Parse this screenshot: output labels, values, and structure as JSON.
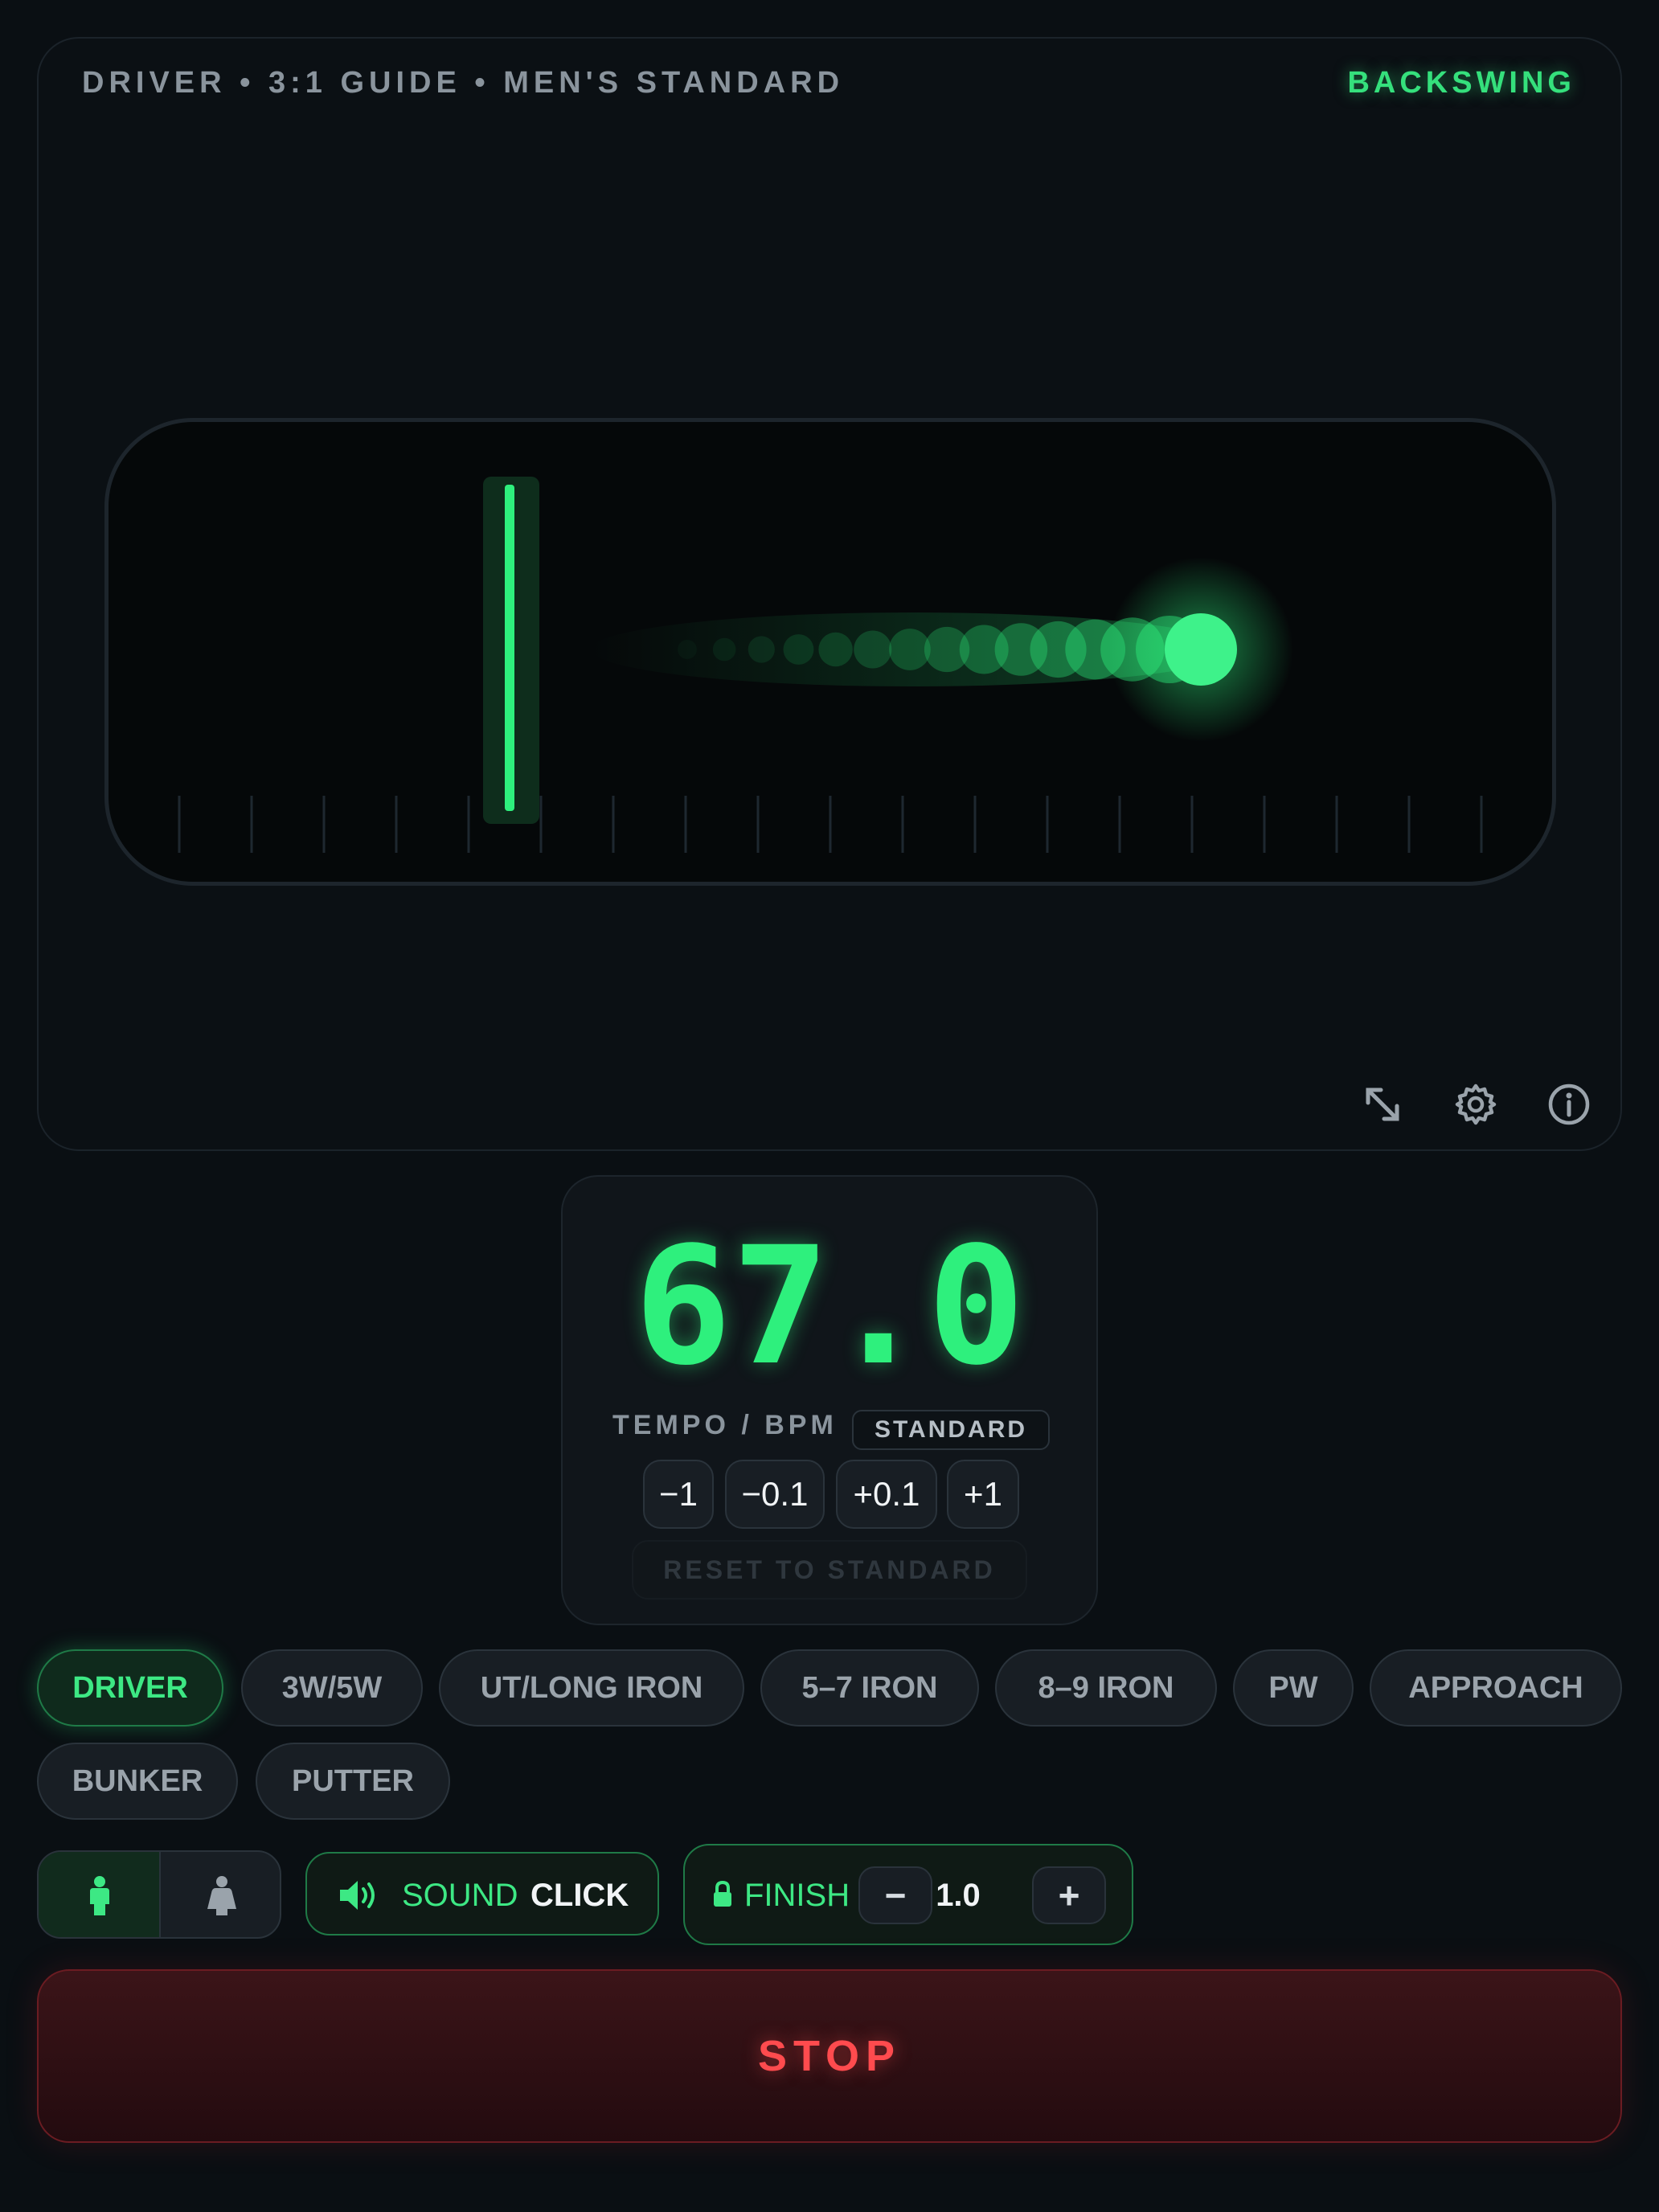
{
  "visualizer": {
    "caption": "DRIVER • 3:1 GUIDE • MEN'S STANDARD",
    "phase": "BACKSWING",
    "icons": [
      "fullscreen-icon",
      "gear-icon",
      "info-icon"
    ]
  },
  "tempo": {
    "value": "67.0",
    "label": "TEMPO / BPM",
    "badge": "STANDARD",
    "steps": [
      "−1",
      "−0.1",
      "+0.1",
      "+1"
    ],
    "reset_label": "RESET TO STANDARD"
  },
  "clubs": {
    "selected": "DRIVER",
    "items": [
      "DRIVER",
      "3W/5W",
      "UT/LONG IRON",
      "5–7 IRON",
      "8–9 IRON",
      "PW",
      "APPROACH",
      "BUNKER",
      "PUTTER"
    ]
  },
  "controls": {
    "gender_icons": [
      "male-icon",
      "female-icon"
    ],
    "sound_label": "SOUND",
    "sound_value": "CLICK",
    "finish_label": "FINISH",
    "finish_minus": "−",
    "finish_plus": "+",
    "finish_value": "1.0"
  },
  "stop_label": "STOP",
  "colors": {
    "accent": "#2ef07d",
    "background": "#0a0f13",
    "stop": "#ff4b4e"
  }
}
